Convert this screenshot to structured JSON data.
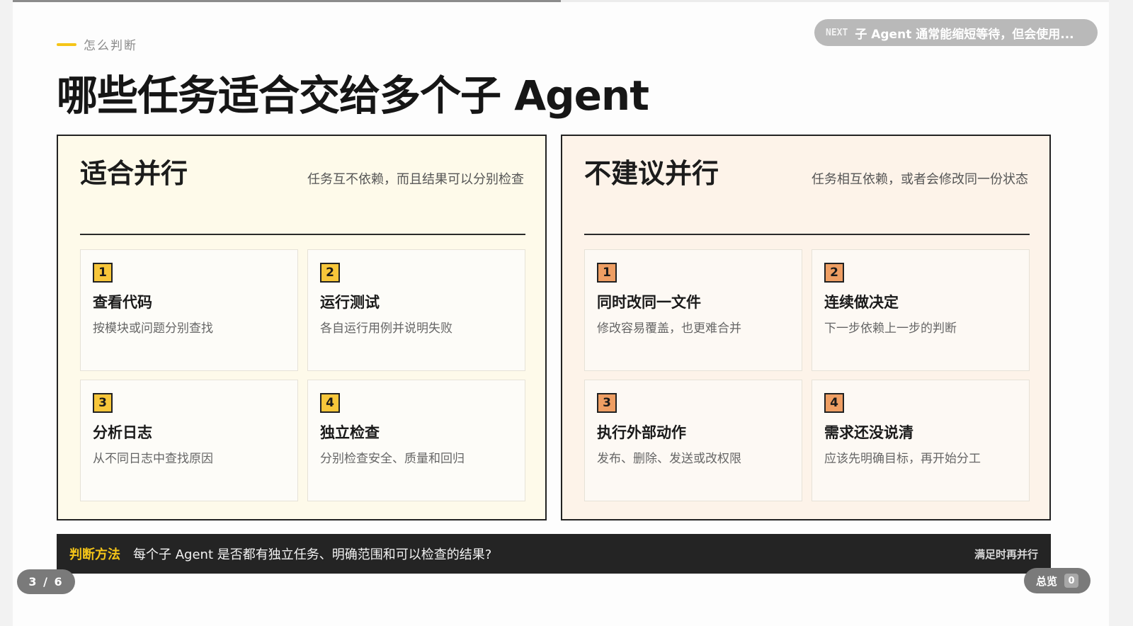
{
  "progress": {
    "fraction": 0.5
  },
  "eyebrow": "怎么判断",
  "title": "哪些任务适合交给多个子 Agent",
  "next": {
    "tag": "NEXT",
    "text": "子 Agent 通常能缩短等待，但会使用..."
  },
  "panels": [
    {
      "title": "适合并行",
      "desc": "任务互不依赖，而且结果可以分别检查",
      "cards": [
        {
          "num": "1",
          "title": "查看代码",
          "desc": "按模块或问题分别查找"
        },
        {
          "num": "2",
          "title": "运行测试",
          "desc": "各自运行用例并说明失败"
        },
        {
          "num": "3",
          "title": "分析日志",
          "desc": "从不同日志中查找原因"
        },
        {
          "num": "4",
          "title": "独立检查",
          "desc": "分别检查安全、质量和回归"
        }
      ]
    },
    {
      "title": "不建议并行",
      "desc": "任务相互依赖，或者会修改同一份状态",
      "cards": [
        {
          "num": "1",
          "title": "同时改同一文件",
          "desc": "修改容易覆盖，也更难合并"
        },
        {
          "num": "2",
          "title": "连续做决定",
          "desc": "下一步依赖上一步的判断"
        },
        {
          "num": "3",
          "title": "执行外部动作",
          "desc": "发布、删除、发送或改权限"
        },
        {
          "num": "4",
          "title": "需求还没说清",
          "desc": "应该先明确目标，再开始分工"
        }
      ]
    }
  ],
  "footer": {
    "label": "判断方法",
    "text": "每个子 Agent 是否都有独立任务、明确范围和可以检查的结果?",
    "right": "满足时再并行"
  },
  "pagination": {
    "text": "3 / 6"
  },
  "overview": {
    "label": "总览",
    "key": "0"
  },
  "colors": {
    "accent": "#f5c518",
    "left_badge": "#f7c63a",
    "right_badge": "#ee9e63",
    "footer_bg": "#242424"
  }
}
